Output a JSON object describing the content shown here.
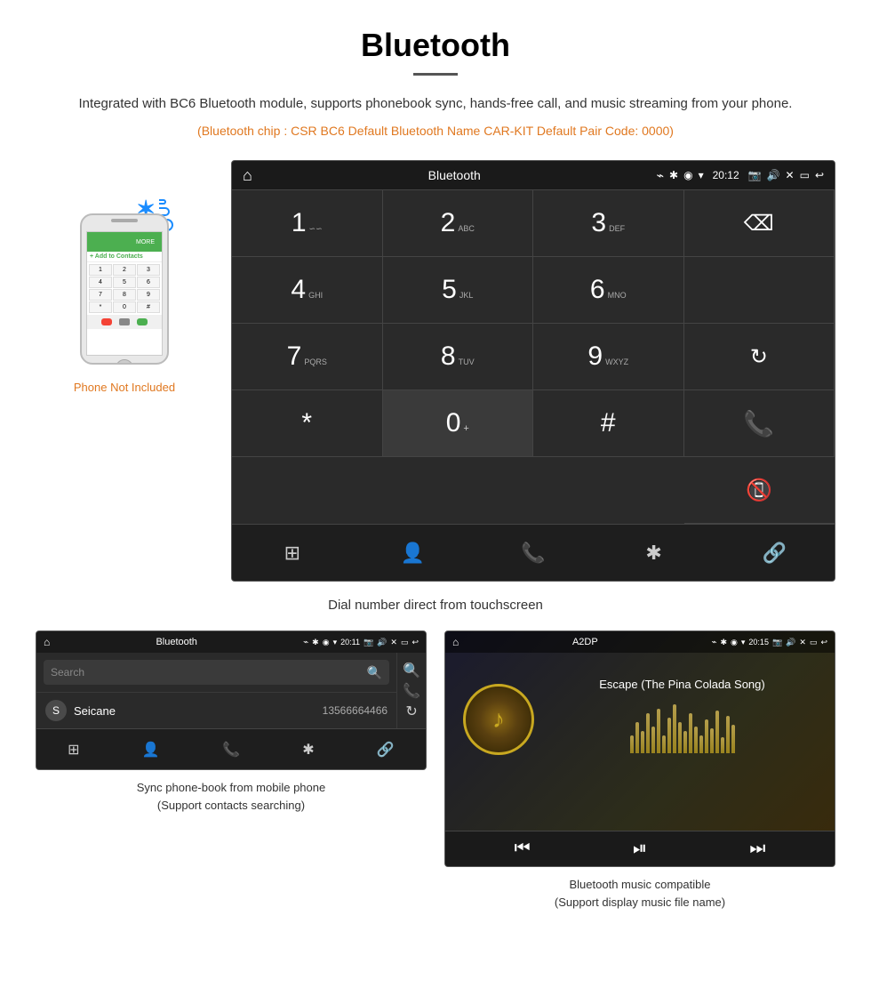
{
  "page": {
    "title": "Bluetooth",
    "divider": true,
    "description": "Integrated with BC6 Bluetooth module, supports phonebook sync, hands-free call, and music streaming from your phone.",
    "specs": "(Bluetooth chip : CSR BC6    Default Bluetooth Name CAR-KIT    Default Pair Code: 0000)",
    "caption_main": "Dial number direct from touchscreen",
    "caption_phonebook": "Sync phone-book from mobile phone\n(Support contacts searching)",
    "caption_music": "Bluetooth music compatible\n(Support display music file name)"
  },
  "main_screen": {
    "status_bar": {
      "home": "⌂",
      "title": "Bluetooth",
      "usb": "⌁",
      "time": "20:12",
      "icons": "✱ ◉ ▾ 📷 🔊 ✕ ▭ ↩"
    },
    "dialpad": [
      {
        "num": "1",
        "sub": "∽∽",
        "row": 0,
        "col": 0
      },
      {
        "num": "2",
        "sub": "ABC",
        "row": 0,
        "col": 1
      },
      {
        "num": "3",
        "sub": "DEF",
        "row": 0,
        "col": 2
      },
      {
        "num": "",
        "sub": "",
        "special": "backspace",
        "row": 0,
        "col": 3
      },
      {
        "num": "4",
        "sub": "GHI",
        "row": 1,
        "col": 0
      },
      {
        "num": "5",
        "sub": "JKL",
        "row": 1,
        "col": 1
      },
      {
        "num": "6",
        "sub": "MNO",
        "row": 1,
        "col": 2
      },
      {
        "num": "",
        "sub": "",
        "special": "empty",
        "row": 1,
        "col": 3
      },
      {
        "num": "7",
        "sub": "PQRS",
        "row": 2,
        "col": 0
      },
      {
        "num": "8",
        "sub": "TUV",
        "row": 2,
        "col": 1
      },
      {
        "num": "9",
        "sub": "WXYZ",
        "row": 2,
        "col": 2
      },
      {
        "num": "",
        "sub": "",
        "special": "refresh",
        "row": 2,
        "col": 3
      },
      {
        "num": "*",
        "sub": "",
        "row": 3,
        "col": 0
      },
      {
        "num": "0",
        "sub": "+",
        "row": 3,
        "col": 1
      },
      {
        "num": "#",
        "sub": "",
        "row": 3,
        "col": 2
      },
      {
        "num": "",
        "sub": "",
        "special": "call-green",
        "row": 3,
        "col": 3
      },
      {
        "num": "",
        "sub": "",
        "special": "call-red",
        "row": 4,
        "col": 3
      }
    ],
    "bottom_icons": [
      "⊞",
      "👤",
      "📞",
      "✱",
      "🔗"
    ]
  },
  "phonebook_screen": {
    "status_title": "Bluetooth",
    "time": "20:11",
    "search_placeholder": "Search",
    "contact": {
      "letter": "S",
      "name": "Seicane",
      "number": "13566664466"
    },
    "right_icons": [
      "🔍",
      "📞",
      "🔄"
    ],
    "bottom_icons": [
      "⊞",
      "👤",
      "📞",
      "✱",
      "🔗"
    ]
  },
  "music_screen": {
    "status_title": "A2DP",
    "time": "20:15",
    "song_title": "Escape (The Pina Colada Song)",
    "note_icon": "♪",
    "controls": [
      "⏮",
      "⏯",
      "⏭"
    ]
  },
  "phone": {
    "not_included": "Phone Not Included",
    "keys": [
      "1",
      "2",
      "3",
      "4",
      "5",
      "6",
      "7",
      "8",
      "9",
      "*",
      "0",
      "#"
    ],
    "contact_label": "Add to Contacts"
  },
  "watermark": "Seicane"
}
